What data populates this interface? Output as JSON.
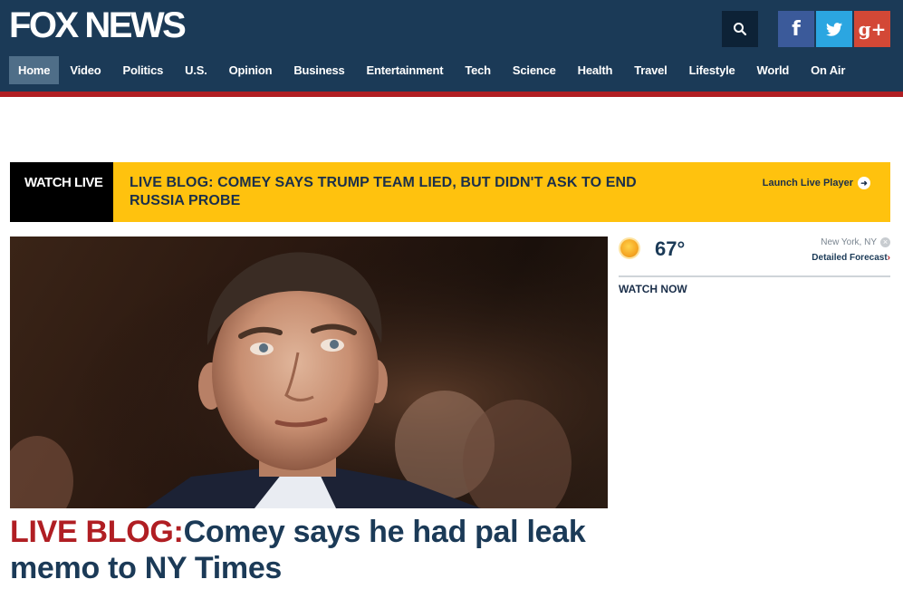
{
  "header": {
    "logo": "FOX NEWS",
    "nav": [
      {
        "label": "Home",
        "active": true
      },
      {
        "label": "Video"
      },
      {
        "label": "Politics"
      },
      {
        "label": "U.S."
      },
      {
        "label": "Opinion"
      },
      {
        "label": "Business"
      },
      {
        "label": "Entertainment"
      },
      {
        "label": "Tech"
      },
      {
        "label": "Science"
      },
      {
        "label": "Health"
      },
      {
        "label": "Travel"
      },
      {
        "label": "Lifestyle"
      },
      {
        "label": "World"
      },
      {
        "label": "On Air"
      }
    ],
    "icons": {
      "search": "search-icon",
      "facebook": "f",
      "twitter": "twitter-icon",
      "googleplus": "g+"
    },
    "colors": {
      "bar": "#1b3a57",
      "accent_line": "#b01e23",
      "active_tab": "#4f6e88"
    }
  },
  "live_bar": {
    "badge": "WATCH LIVE",
    "headline": "LIVE BLOG: COMEY SAYS TRUMP TEAM LIED, BUT DIDN'T ASK TO END RUSSIA PROBE",
    "launch_label": "Launch Live Player",
    "color": "#ffc20e"
  },
  "main_story": {
    "kicker": "LIVE BLOG:",
    "title": "Comey says he had pal leak memo to NY Times"
  },
  "weather": {
    "icon": "sun-icon",
    "temperature": "67°",
    "location": "New York, NY",
    "forecast_link": "Detailed Forecast",
    "forecast_chevron": "›"
  },
  "sidebar": {
    "watch_now": "WATCH NOW"
  }
}
